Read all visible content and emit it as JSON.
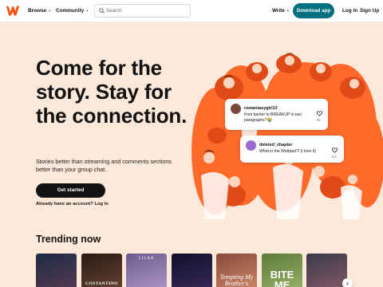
{
  "nav": {
    "browse": "Browse",
    "community": "Community",
    "search_placeholder": "Search",
    "write": "Write",
    "download_app": "Download app",
    "login": "Log in",
    "signup": "Sign Up"
  },
  "hero": {
    "title": "Come for the story. Stay for the connection.",
    "subtitle": "Stories better than streaming and comments sections better than your group chat.",
    "cta": "Get started",
    "login_prompt": "Already have an account? Log in"
  },
  "comments": [
    {
      "username": "romantasygirl13",
      "text": "from banter to BREAKUP in two paragraphs?😭",
      "likes": "65"
    },
    {
      "username": "deleted_chapter",
      "text": "What in the Wattpad?! (i love it)",
      "likes": "112"
    }
  ],
  "trending": {
    "title": "Trending now",
    "books": [
      {
        "title": ""
      },
      {
        "title": "COSTANTINO"
      },
      {
        "title": "LILAH"
      },
      {
        "title": ""
      },
      {
        "title": "Tempting My Brother's"
      },
      {
        "title": "BITE ME"
      },
      {
        "title": ""
      }
    ]
  },
  "colors": {
    "brand": "#ff500a",
    "download_button": "#00707f",
    "hero_background": "#fde9da",
    "illustration": "#ff6a2b"
  },
  "icons": [
    "wattpad-logo-icon",
    "search-icon",
    "chevron-down-icon",
    "heart-icon",
    "chevron-right-icon"
  ]
}
